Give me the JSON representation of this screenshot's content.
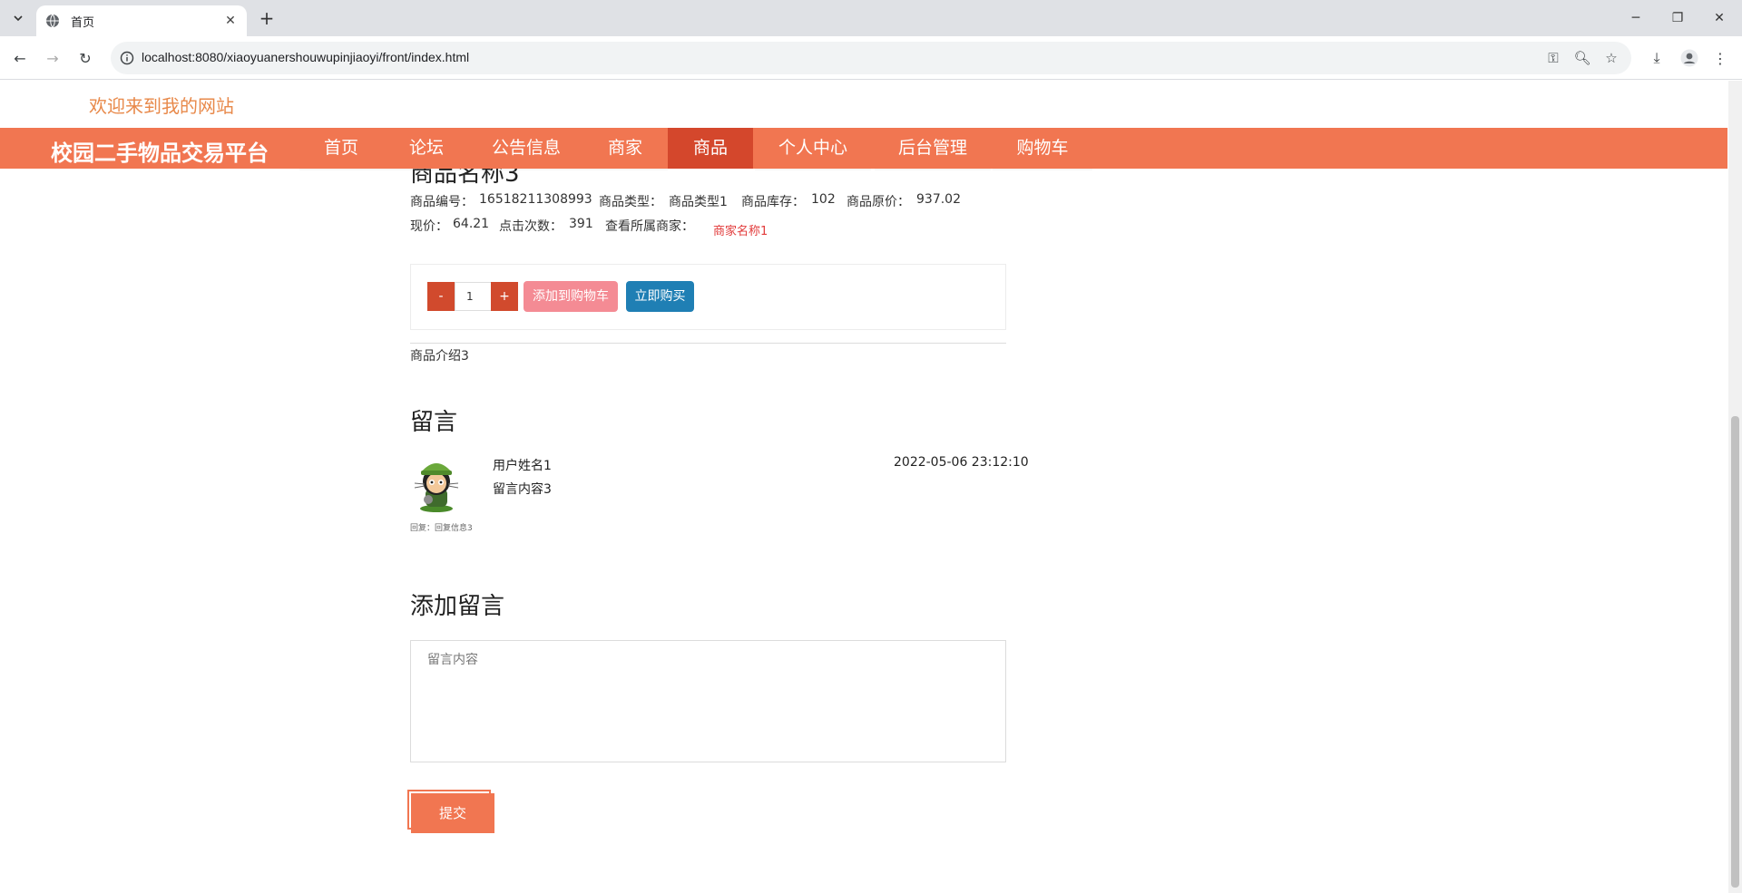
{
  "browser": {
    "tab_title": "首页",
    "url": "localhost:8080/xiaoyuanershouwupinjiaoyi/front/index.html"
  },
  "site": {
    "welcome": "欢迎来到我的网站",
    "brand": "校园二手物品交易平台",
    "nav": [
      "首页",
      "论坛",
      "公告信息",
      "商家",
      "商品",
      "个人中心",
      "后台管理",
      "购物车"
    ],
    "active_nav": "商品"
  },
  "product": {
    "name": "商品名称3",
    "code_label": "商品编号：",
    "code": "16518211308993",
    "type_label": "商品类型：",
    "type": "商品类型1",
    "stock_label": "商品库存：",
    "stock": "102",
    "orig_price_label": "商品原价：",
    "orig_price": "937.02",
    "price_label": "现价：",
    "price": "64.21",
    "clicks_label": "点击次数：",
    "clicks": "391",
    "merchant_label": "查看所属商家：",
    "merchant": "商家名称1",
    "intro": "商品介绍3"
  },
  "purchase": {
    "minus": "-",
    "quantity": "1",
    "plus": "+",
    "add_to_cart": "添加到购物车",
    "buy_now": "立即购买"
  },
  "comments": {
    "title": "留言",
    "items": [
      {
        "user": "用户姓名1",
        "content": "留言内容3",
        "time": "2022-05-06 23:12:10",
        "reply": "回复：回复信息3"
      }
    ]
  },
  "add_comment": {
    "title": "添加留言",
    "placeholder": "留言内容",
    "submit": "提交"
  }
}
